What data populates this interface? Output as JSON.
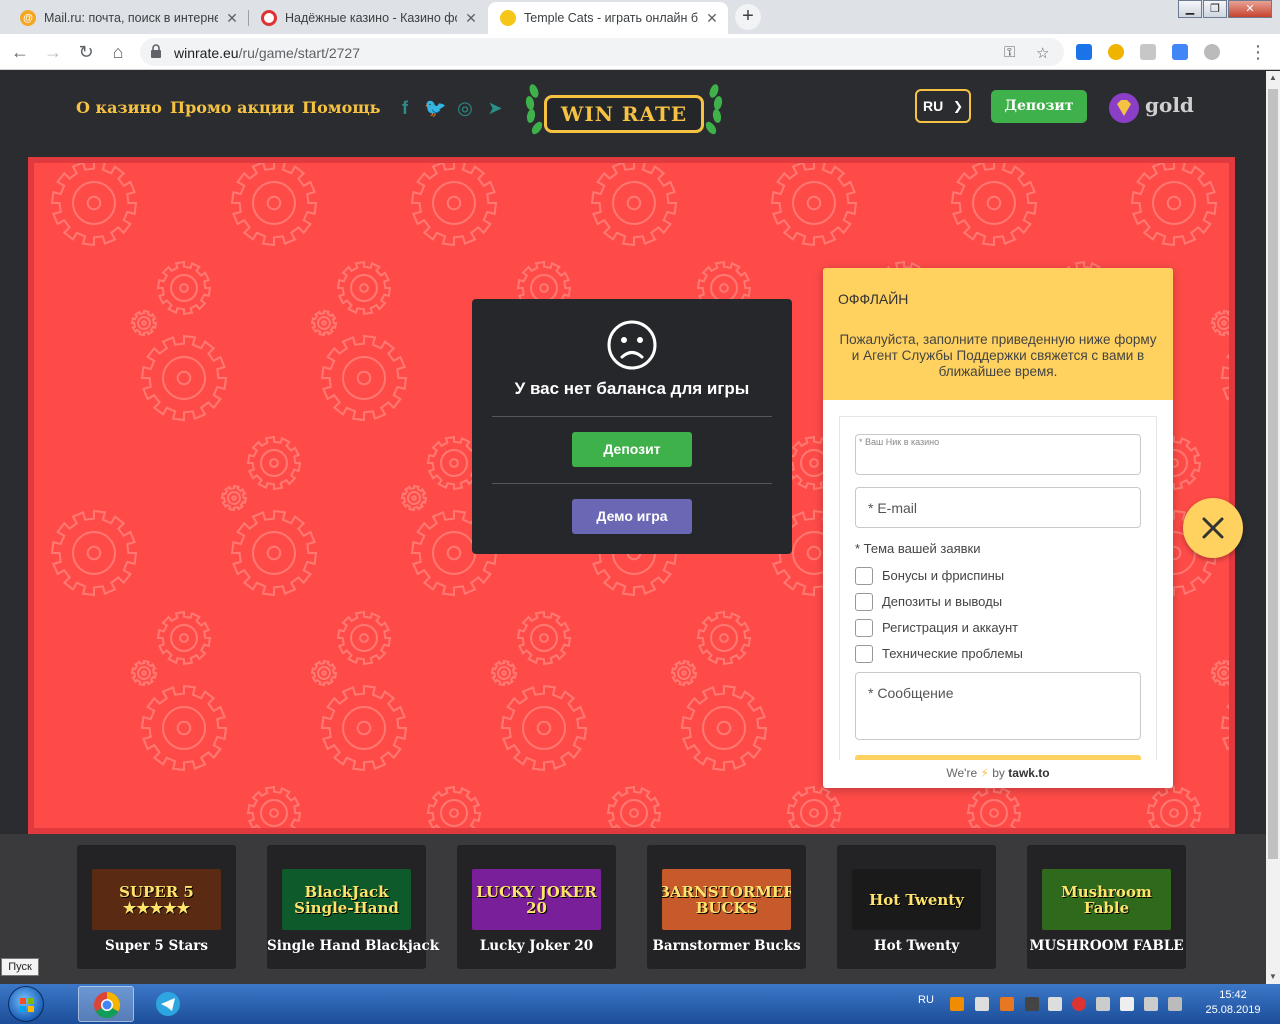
{
  "browser": {
    "tabs": [
      {
        "title": "Mail.ru: почта, поиск в интернете",
        "favicon": "mailru-icon",
        "active": false
      },
      {
        "title": "Надёжные казино - Казино фор",
        "favicon": "casino-icon",
        "active": false
      },
      {
        "title": "Temple Cats - играть онлайн бе",
        "favicon": "coin-icon",
        "active": true
      }
    ],
    "url_domain": "winrate.eu",
    "url_path": "/ru/game/start/2727"
  },
  "site": {
    "nav": [
      "О казино",
      "Промо акции",
      "Помощь"
    ],
    "social_icons": [
      "facebook-icon",
      "twitter-icon",
      "instagram-icon",
      "telegram-icon"
    ],
    "logo_text": "WIN RATE",
    "lang": "RU",
    "deposit_label": "Депозит",
    "gold_label": "gold",
    "colors": {
      "accent": "#f5c242",
      "green": "#3fb14a",
      "game_bg": "#ff4b48"
    }
  },
  "modal": {
    "message": "У вас нет баланса для игры",
    "deposit_label": "Депозит",
    "demo_label": "Демо игра"
  },
  "tawk": {
    "status": "ОФФЛАЙН",
    "intro": "Пожалуйста, заполните приведенную ниже форму и Агент Службы Поддержки свяжется с вами в ближайшее время.",
    "nick_placeholder": "* Ваш Ник в казино",
    "email_placeholder": "* E-mail",
    "topic_label": "* Тема вашей заявки",
    "topics": [
      "Бонусы и фриспины",
      "Депозиты и выводы",
      "Регистрация и аккаунт",
      "Технические проблемы"
    ],
    "message_placeholder": "* Сообщение",
    "footer_prefix": "We're",
    "footer_by": "by",
    "footer_brand": "tawk.to"
  },
  "games": [
    {
      "name": "Super 5 Stars",
      "thumb_text": "SUPER 5 ★★★★★",
      "thumb_color": "#5a2a12"
    },
    {
      "name": "Single Hand Blackjack",
      "thumb_text": "BlackJack Single-Hand",
      "thumb_color": "#0f5a2a"
    },
    {
      "name": "Lucky Joker 20",
      "thumb_text": "LUCKY JOKER 20",
      "thumb_color": "#7a1f9a"
    },
    {
      "name": "Barnstormer Bucks",
      "thumb_text": "BARNSTORMER BUCKS",
      "thumb_color": "#c65a2a"
    },
    {
      "name": "Hot Twenty",
      "thumb_text": "Hot Twenty",
      "thumb_color": "#1a1a1a"
    },
    {
      "name": "MUSHROOM FABLE",
      "thumb_text": "Mushroom Fable",
      "thumb_color": "#2f6a1c"
    }
  ],
  "os": {
    "start_tooltip": "Пуск",
    "tray_lang": "RU",
    "time": "15:42",
    "date": "25.08.2019"
  }
}
